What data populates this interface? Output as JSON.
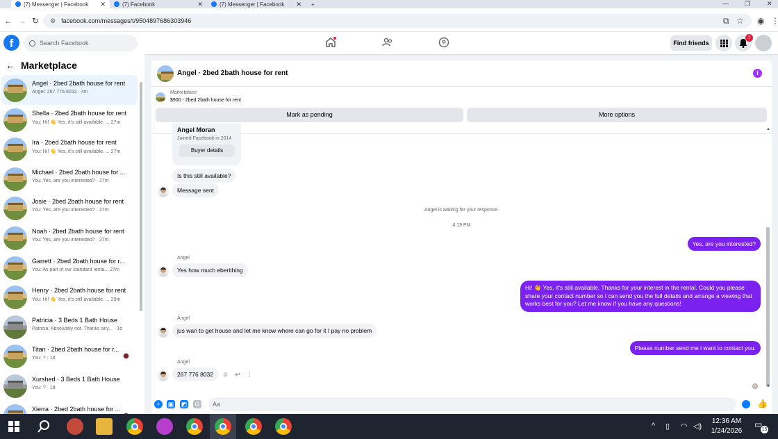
{
  "browser": {
    "tabs": [
      {
        "title": "(7) Messenger | Facebook",
        "active": true
      },
      {
        "title": "(7) Facebook",
        "active": false
      },
      {
        "title": "(7) Messenger | Facebook",
        "active": false
      }
    ],
    "url": "facebook.com/messages/t/9504897686303946"
  },
  "header": {
    "search_placeholder": "Search Facebook",
    "find_friends": "Find friends",
    "notification_count": "7"
  },
  "sidebar": {
    "title": "Marketplace",
    "items": [
      {
        "name": "Angel · 2bed 2bath house for rent",
        "preview": "Angel: 267 776 8032 · 4m"
      },
      {
        "name": "Shella · 2bed 2bath house for rent",
        "preview": "You: Hi! 👋 Yes, it's still available. ... 27m"
      },
      {
        "name": "Ira · 2bed 2bath house for rent",
        "preview": "You: Hi! 👋 Yes, it's still available. ... 27m"
      },
      {
        "name": "Michael · 2bed 2bath house for ...",
        "preview": "You: Yes, are you interested? · 27m"
      },
      {
        "name": "Josie · 2bed 2bath house for rent",
        "preview": "You: Yes, are you interested? · 27m"
      },
      {
        "name": "Noah · 2bed 2bath house for rent",
        "preview": "You: Yes, are you interested? · 27m"
      },
      {
        "name": "Garrett · 2bed 2bath house for r...",
        "preview": "You: As part of our standard renta... 27m"
      },
      {
        "name": "Henry · 2bed 2bath house for rent",
        "preview": "You: Hi! 👋 Yes, it's still available. ... 29m"
      },
      {
        "name": "Patricia · 3 Beds 1 Bath House",
        "preview": "Patricia: Absolutely not. Thanks any... · 1d"
      },
      {
        "name": "Titan · 2bed 2bath house for r...",
        "preview": "You: ? · 1d"
      },
      {
        "name": "Xurshed · 3 Beds 1 Bath House",
        "preview": "You: ? · 1d"
      },
      {
        "name": "Xierra · 2bed 2bath house for ...",
        "preview": ""
      }
    ]
  },
  "chat": {
    "title": "Angel · 2bed 2bath house for rent",
    "marketplace_label": "Marketplace",
    "listing": "$900 - 2bed 2bath house for rent",
    "mark_pending": "Mark as pending",
    "more_options": "More options",
    "card": {
      "name": "Angel Moran",
      "joined": "Joined Facebook in 2014",
      "button": "Buyer details"
    },
    "messages": {
      "still_available": "Is this still available?",
      "message_sent": "Message sent",
      "waiting": "Angel is waiting for your response.",
      "time": "4:19 PM",
      "out1": "Yes, are you interested?",
      "sender": "Angel",
      "in1": "Yes how much eberithing",
      "out2": "Hi! 👋 Yes, it's still available. Thanks for your interest in the rental. Could you please share your contact number so I can send you the full details and arrange a viewing that works best for you? Let me know if you have any questions!",
      "in2": "jus wan to get house and let me know where can go for it I pay no problem",
      "out3": "Please number send me i want to contact you.",
      "in3": "267 776 8032"
    },
    "composer_placeholder": "Aa"
  },
  "taskbar": {
    "time": "12:36 AM",
    "date": "1/24/2026",
    "notifications": "15"
  }
}
